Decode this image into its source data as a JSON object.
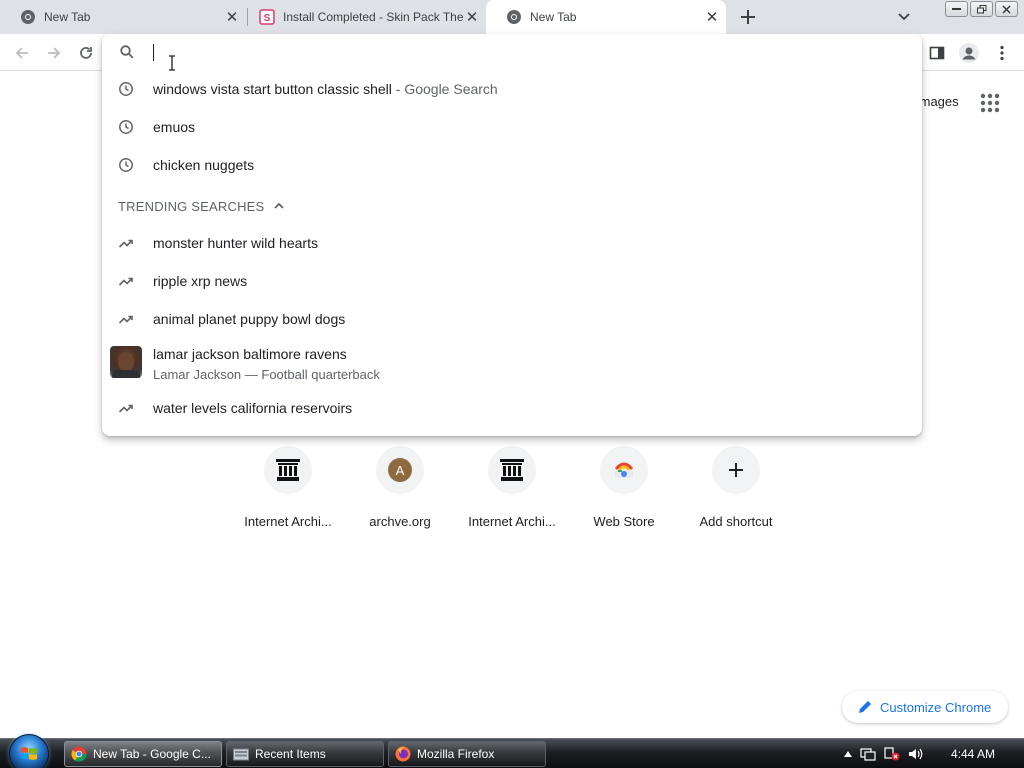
{
  "tabs": [
    {
      "title": "New Tab",
      "active": false
    },
    {
      "title": "Install Completed - Skin Pack The",
      "active": false
    },
    {
      "title": "New Tab",
      "active": true
    }
  ],
  "omnibox": {
    "value": "",
    "history": [
      {
        "text": "windows vista start button classic shell",
        "desc": " - Google Search"
      },
      {
        "text": "emuos",
        "desc": ""
      },
      {
        "text": "chicken nuggets",
        "desc": ""
      }
    ],
    "trending_header": "TRENDING SEARCHES",
    "trending": [
      {
        "text": "monster hunter wild hearts"
      },
      {
        "text": "ripple xrp news"
      },
      {
        "text": "animal planet puppy bowl dogs"
      }
    ],
    "entity": {
      "title": "lamar jackson baltimore ravens",
      "desc": "Lamar Jackson — Football quarterback"
    },
    "trending_last": {
      "text": "water levels california reservoirs"
    }
  },
  "ntp": {
    "images_link": "Images",
    "shortcuts": [
      {
        "label": "Internet Archi...",
        "icon": "archive-icon"
      },
      {
        "label": "archve.org",
        "icon": "letter-a-icon",
        "letter": "A"
      },
      {
        "label": "Internet Archi...",
        "icon": "archive-icon"
      },
      {
        "label": "Web Store",
        "icon": "webstore-icon"
      },
      {
        "label": "Add shortcut",
        "icon": "plus-icon"
      }
    ],
    "customize_label": "Customize Chrome"
  },
  "taskbar": {
    "items": [
      {
        "label": "New Tab - Google C...",
        "icon": "chrome-icon",
        "active": true
      },
      {
        "label": "Recent Items",
        "icon": "folder-icon",
        "active": false
      },
      {
        "label": "Mozilla Firefox",
        "icon": "firefox-icon",
        "active": false
      }
    ],
    "clock": "4:44 AM"
  },
  "colors": {
    "accent": "#1a73e8",
    "tabstrip": "#dee1e6"
  }
}
